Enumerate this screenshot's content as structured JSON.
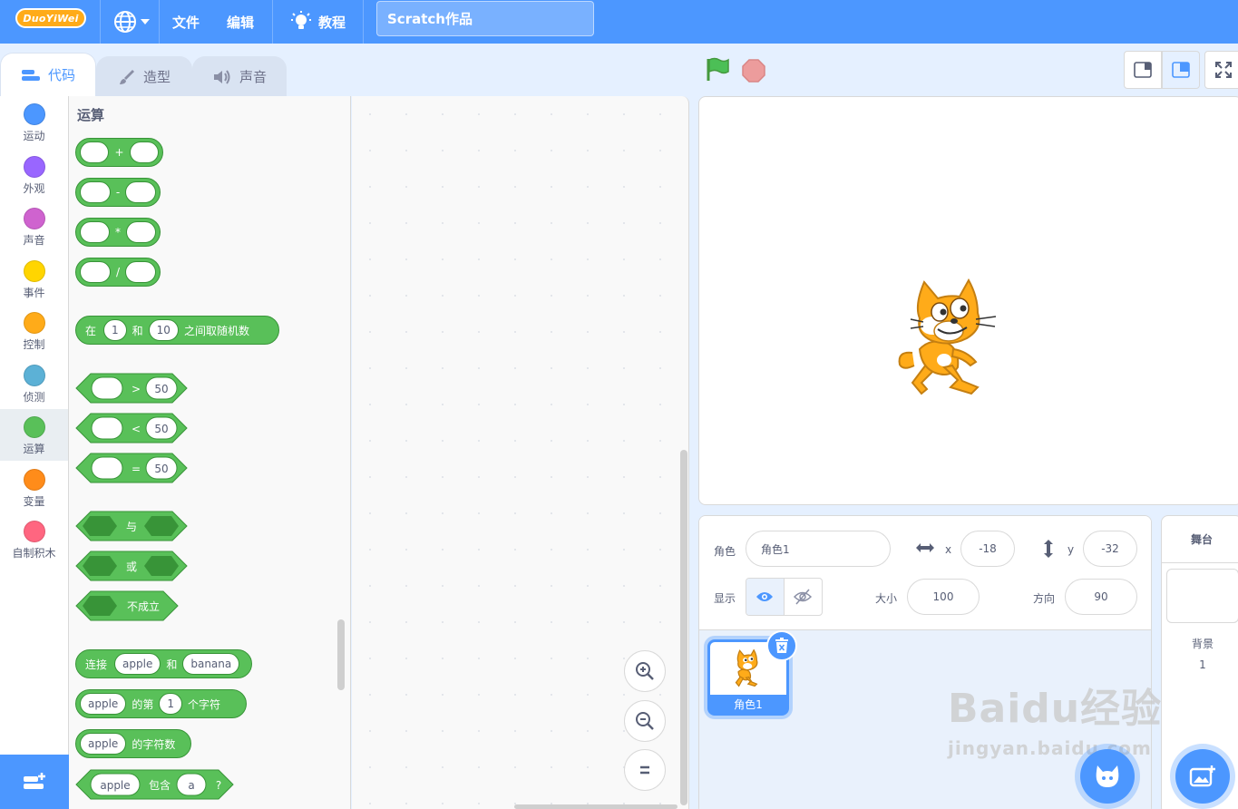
{
  "menubar": {
    "logo": "DuoYiWei",
    "file": "文件",
    "edit": "编辑",
    "tutorial": "教程",
    "project_title": "Scratch作品"
  },
  "tabs": [
    {
      "label": "代码",
      "active": true
    },
    {
      "label": "造型",
      "active": false
    },
    {
      "label": "声音",
      "active": false
    }
  ],
  "categories": [
    {
      "label": "运动",
      "color": "#4c97ff"
    },
    {
      "label": "外观",
      "color": "#9966ff"
    },
    {
      "label": "声音",
      "color": "#cf63cf"
    },
    {
      "label": "事件",
      "color": "#ffd500"
    },
    {
      "label": "控制",
      "color": "#ffab19"
    },
    {
      "label": "侦测",
      "color": "#5cb1d6"
    },
    {
      "label": "运算",
      "color": "#59c059",
      "selected": true
    },
    {
      "label": "变量",
      "color": "#ff8c1a"
    },
    {
      "label": "自制积木",
      "color": "#ff6680"
    }
  ],
  "palette": {
    "title": "运算",
    "ops": [
      "+",
      "-",
      "*",
      "/"
    ],
    "random": {
      "prefix": "在",
      "from": "1",
      "and": "和",
      "to": "10",
      "suffix": "之间取随机数"
    },
    "compare": [
      {
        "op": ">",
        "value": "50"
      },
      {
        "op": "<",
        "value": "50"
      },
      {
        "op": "=",
        "value": "50"
      }
    ],
    "logic": {
      "and": "与",
      "or": "或",
      "not": "不成立"
    },
    "join": {
      "prefix": "连接",
      "a": "apple",
      "and": "和",
      "b": "banana"
    },
    "letter_of": {
      "text": "apple",
      "mid": "的第",
      "index": "1",
      "suffix": "个字符"
    },
    "length_of": {
      "text": "apple",
      "suffix": "的字符数"
    },
    "contains": {
      "text": "apple",
      "mid": "包含",
      "sub": "a",
      "suffix": "?"
    }
  },
  "sprite_info": {
    "sprite_label": "角色",
    "sprite_name": "角色1",
    "x_label": "x",
    "x_value": "-18",
    "y_label": "y",
    "y_value": "-32",
    "show_label": "显示",
    "size_label": "大小",
    "size_value": "100",
    "direction_label": "方向",
    "direction_value": "90"
  },
  "sprites": [
    {
      "name": "角色1"
    }
  ],
  "stage_pane": {
    "title": "舞台",
    "backdrop_label": "背景",
    "backdrop_count": "1"
  },
  "watermark": {
    "line1": "Baidu经验",
    "line2": "jingyan.baidu.com"
  },
  "colors": {
    "accent": "#4c97ff",
    "operators": "#59c059",
    "operators_dark": "#389438"
  }
}
